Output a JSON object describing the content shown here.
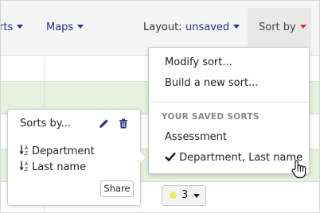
{
  "toolbar": {
    "reports_partial": "rts",
    "maps_label": "Maps",
    "layout_label": "Layout:",
    "layout_value": "unsaved",
    "sort_by_label": "Sort by"
  },
  "sort_menu": {
    "items": [
      "Modify sort...",
      "Build a new sort..."
    ],
    "saved_header": "YOUR SAVED SORTS",
    "saved_sorts": [
      "Assessment",
      "Department, Last name"
    ],
    "checked_index": 1
  },
  "popover": {
    "title": "Sorts by...",
    "fields": [
      "Department",
      "Last name"
    ],
    "share_label": "Share"
  },
  "badge": {
    "value": "3",
    "dot_color": "#f2e85c"
  },
  "colors": {
    "link": "#2a2f86",
    "row_highlight": "#e6f1df"
  }
}
